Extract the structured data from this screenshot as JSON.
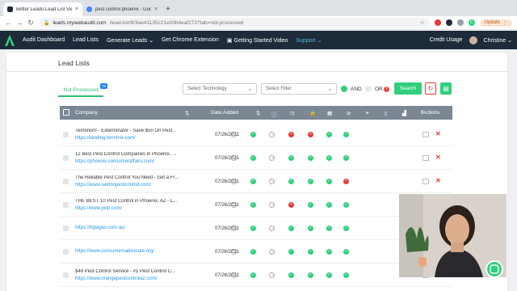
{
  "browser": {
    "tabs": [
      {
        "title": "Better Leads-Lead List View",
        "active": true,
        "favicon_color": "#1d2b3a"
      },
      {
        "title": "pest control phoenix - Google Se",
        "active": false,
        "favicon_color": "#4285f4"
      }
    ],
    "url_host": "leads.mywebaudit.com",
    "url_path": "/lead-list/60fae41135c21e03b4eaf273?tab=not-processed",
    "update_label": "Update",
    "profile_initial": "C"
  },
  "nav": {
    "items": [
      "Audit Dashboard",
      "Lead Lists",
      "Generate Leads",
      "Get Chrome Extension",
      "Getting Started Video",
      "Support"
    ],
    "credit_usage": "Credit Usage",
    "user_name": "Christine"
  },
  "page": {
    "title": "Lead Lists",
    "tab_label": "Not Processed",
    "tab_count": "76",
    "select_technology_placeholder": "Select Technology",
    "select_filter_placeholder": "Select Filter",
    "and_label": "AND",
    "or_label": "OR",
    "search_label": "Search"
  },
  "table": {
    "headers": {
      "company": "Company",
      "date_added": "Date Added",
      "actions": "Actions"
    },
    "rows": [
      {
        "name": "Terminix® - Exterminator - Save $50 On Pest...",
        "url": "https://landing.terminix.com/",
        "date": "07/26/2021",
        "dash": "-",
        "status": [
          "ld",
          "ok",
          "ld",
          "no",
          "no",
          "ok",
          "ok"
        ]
      },
      {
        "name": "12 Best Pest Control Companies in Phoenix, ...",
        "url": "https://phoenix.consumeraffairs.com/",
        "date": "07/26/2021",
        "dash": "-",
        "status": [
          "ld",
          "ok",
          "ld",
          "ok",
          "ok",
          "ok",
          "ok"
        ]
      },
      {
        "name": "The Reliable Pest Control You Need - Get a Fr...",
        "url": "https://www.sextonpestcontrol.com/",
        "date": "07/26/2021",
        "dash": "-",
        "status": [
          "ld",
          "ok",
          "ld",
          "ok",
          "ok",
          "ok",
          "no"
        ]
      },
      {
        "name": "THE BEST 10 Pest Control in Phoenix, AZ - L...",
        "url": "https://www.yelp.com/",
        "date": "07/26/2021",
        "dash": "-",
        "status": [
          "ld",
          "ok",
          "ld",
          "no",
          "ok",
          "ok",
          "ok"
        ]
      },
      {
        "name": "",
        "url": "https://hipages.com.au/",
        "date": "07/26/2021",
        "dash": "-",
        "status": [
          "ld",
          "ok",
          "ld",
          "ok",
          "ok",
          "ok",
          "ok"
        ]
      },
      {
        "name": "",
        "url": "https://www.consumersadvocate.org/",
        "date": "07/26/2021",
        "dash": "-",
        "status": [
          "ld",
          "ok",
          "ld",
          "ok",
          "ok",
          "ok",
          "ok"
        ]
      },
      {
        "name": "$49 Pest Control Service - #1 Pest Control C...",
        "url": "https://www.orangepestcontrolaz.com/",
        "date": "07/26/2021",
        "dash": "-",
        "status": [
          "ld",
          "ok",
          "ld",
          "ok",
          "ok",
          "ok",
          "ok"
        ]
      }
    ]
  },
  "colors": {
    "nav_bg": "#1d2b3a",
    "accent_green": "#2fcf7c",
    "danger_red": "#e53935",
    "link_blue": "#2196f3",
    "header_gray": "#7b8793"
  }
}
